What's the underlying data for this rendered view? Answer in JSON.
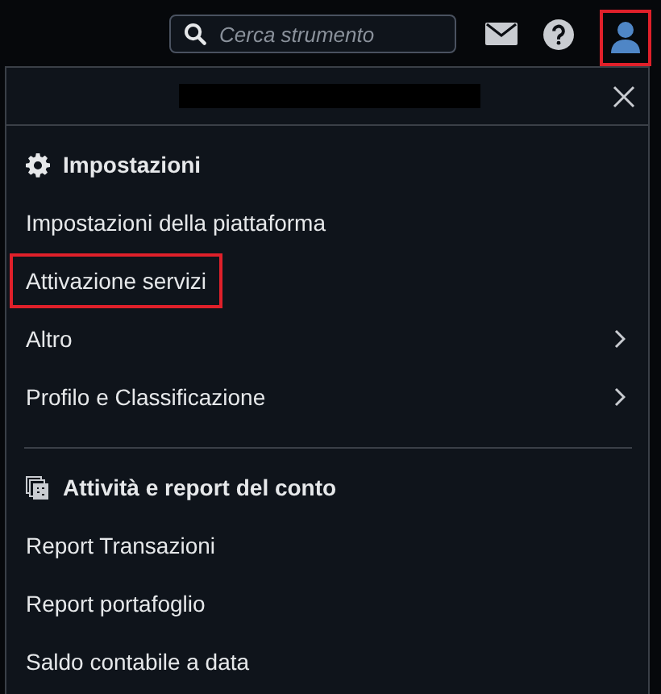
{
  "search": {
    "placeholder": "Cerca strumento"
  },
  "user_button": {
    "highlighted": true
  },
  "menu": {
    "sections": [
      {
        "kind": "settings",
        "title": "Impostazioni",
        "items": [
          {
            "label": "Impostazioni della piattaforma",
            "has_submenu": false,
            "highlighted": false
          },
          {
            "label": "Attivazione servizi",
            "has_submenu": false,
            "highlighted": true
          },
          {
            "label": "Altro",
            "has_submenu": true,
            "highlighted": false
          },
          {
            "label": "Profilo e Classificazione",
            "has_submenu": true,
            "highlighted": false
          }
        ]
      },
      {
        "kind": "reports",
        "title": "Attività e report del conto",
        "items": [
          {
            "label": "Report Transazioni",
            "has_submenu": false,
            "highlighted": false
          },
          {
            "label": "Report portafoglio",
            "has_submenu": false,
            "highlighted": false
          },
          {
            "label": "Saldo contabile a data",
            "has_submenu": false,
            "highlighted": false
          }
        ]
      }
    ]
  }
}
